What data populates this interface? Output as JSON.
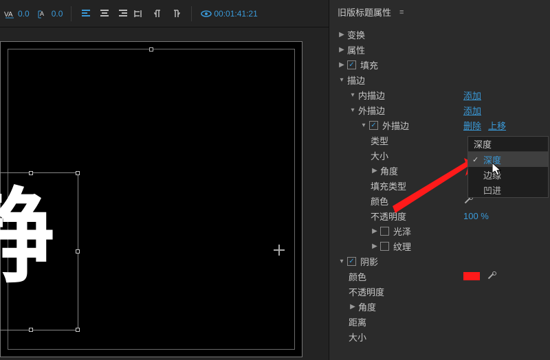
{
  "toolbar": {
    "kerning_value": "0.0",
    "baseline_value": "0.0",
    "timecode": "00:01:41:21"
  },
  "panel": {
    "title": "旧版标题属性",
    "sections": {
      "transform": "变换",
      "properties": "属性",
      "fill": "填充",
      "stroke": "描边",
      "inner_stroke": "内描边",
      "outer_stroke": "外描边",
      "outer_stroke_enable": "外描边",
      "type_label": "类型",
      "size_label": "大小",
      "angle_label": "角度",
      "fill_type_label": "填充类型",
      "color_label": "颜色",
      "opacity_label": "不透明度",
      "opacity_value": "100 %",
      "sheen_label": "光泽",
      "texture_label": "纹理",
      "shadow": "阴影",
      "shadow_color_label": "颜色",
      "shadow_opacity_label": "不透明度",
      "shadow_angle_label": "角度",
      "distance_label": "距离",
      "shadow_size_label": "大小"
    },
    "links": {
      "add": "添加",
      "delete": "删除",
      "move_up": "上移"
    }
  },
  "dropdown": {
    "current": "深度",
    "options": [
      "深度",
      "边缘",
      "凹进"
    ],
    "selected_index": 0
  },
  "canvas": {
    "glyph": "静"
  }
}
